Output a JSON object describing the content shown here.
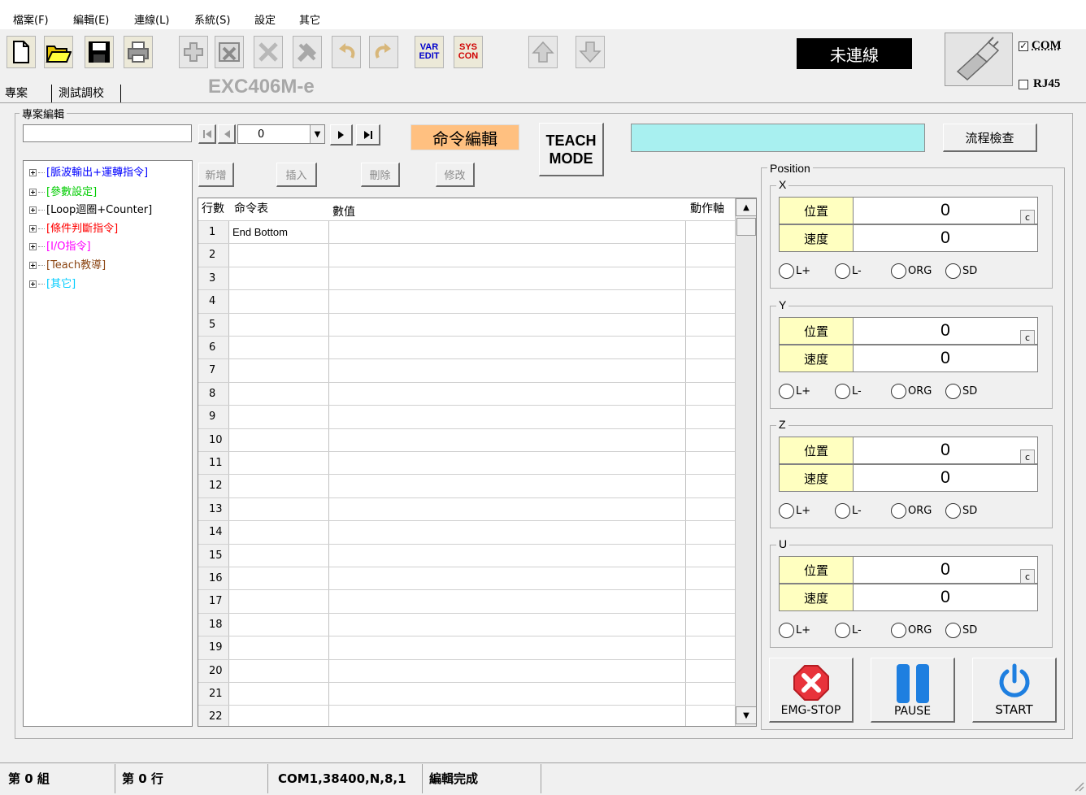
{
  "menu": [
    "檔案(F)",
    "編輯(E)",
    "連線(L)",
    "系統(S)",
    "設定",
    "其它"
  ],
  "toolbar": {
    "var_edit": "VAR EDIT",
    "sys_con": "SYS CON",
    "var_line1": "VAR",
    "var_line2": "EDIT",
    "sys_line1": "SYS",
    "sys_line2": "CON",
    "icons": [
      "new-file-icon",
      "open-folder-icon",
      "save-icon",
      "print-icon",
      "add-icon",
      "delete-window-icon",
      "cross-icon",
      "tools-icon",
      "undo-icon",
      "redo-icon",
      "var-edit-icon",
      "sys-con-icon",
      "arrow-up-icon",
      "arrow-down-icon"
    ]
  },
  "connection": {
    "status": "未連線",
    "com_label": "COM",
    "com_checked": true,
    "rj45_label": "RJ45",
    "rj45_checked": false
  },
  "model_name": "EXC406M-e",
  "tabs": [
    "專案",
    "測試調校"
  ],
  "project": {
    "group_title": "專案編輯",
    "name_value": "",
    "nav_value": "0",
    "cmd_edit_label": "命令編輯",
    "teach_line1": "TEACH",
    "teach_line2": "MODE",
    "info_value": "",
    "flow_check": "流程檢查",
    "buttons": {
      "add": "新增",
      "insert": "插入",
      "delete": "刪除",
      "modify": "修改"
    }
  },
  "tree": [
    {
      "label": "[脈波輸出+運轉指令]",
      "color": "#0000ff"
    },
    {
      "label": "[參數設定]",
      "color": "#00cc00"
    },
    {
      "label": "[Loop迴圈+Counter]",
      "color": "#000000"
    },
    {
      "label": "[條件判斷指令]",
      "color": "#ff0000"
    },
    {
      "label": "[I/O指令]",
      "color": "#ff00ff"
    },
    {
      "label": "[Teach教導]",
      "color": "#8b4513"
    },
    {
      "label": "[其它]",
      "color": "#00ccff"
    }
  ],
  "grid": {
    "headers": [
      "行數",
      "命令表",
      "數值",
      "動作軸"
    ],
    "rows": [
      {
        "no": "1",
        "cmd": "End Bottom",
        "val": "",
        "axis": ""
      },
      {
        "no": "2",
        "cmd": "",
        "val": "",
        "axis": ""
      },
      {
        "no": "3",
        "cmd": "",
        "val": "",
        "axis": ""
      },
      {
        "no": "4",
        "cmd": "",
        "val": "",
        "axis": ""
      },
      {
        "no": "5",
        "cmd": "",
        "val": "",
        "axis": ""
      },
      {
        "no": "6",
        "cmd": "",
        "val": "",
        "axis": ""
      },
      {
        "no": "7",
        "cmd": "",
        "val": "",
        "axis": ""
      },
      {
        "no": "8",
        "cmd": "",
        "val": "",
        "axis": ""
      },
      {
        "no": "9",
        "cmd": "",
        "val": "",
        "axis": ""
      },
      {
        "no": "10",
        "cmd": "",
        "val": "",
        "axis": ""
      },
      {
        "no": "11",
        "cmd": "",
        "val": "",
        "axis": ""
      },
      {
        "no": "12",
        "cmd": "",
        "val": "",
        "axis": ""
      },
      {
        "no": "13",
        "cmd": "",
        "val": "",
        "axis": ""
      },
      {
        "no": "14",
        "cmd": "",
        "val": "",
        "axis": ""
      },
      {
        "no": "15",
        "cmd": "",
        "val": "",
        "axis": ""
      },
      {
        "no": "16",
        "cmd": "",
        "val": "",
        "axis": ""
      },
      {
        "no": "17",
        "cmd": "",
        "val": "",
        "axis": ""
      },
      {
        "no": "18",
        "cmd": "",
        "val": "",
        "axis": ""
      },
      {
        "no": "19",
        "cmd": "",
        "val": "",
        "axis": ""
      },
      {
        "no": "20",
        "cmd": "",
        "val": "",
        "axis": ""
      },
      {
        "no": "21",
        "cmd": "",
        "val": "",
        "axis": ""
      },
      {
        "no": "22",
        "cmd": "",
        "val": "",
        "axis": ""
      }
    ]
  },
  "position": {
    "title": "Position",
    "pos_label": "位置",
    "speed_label": "速度",
    "clear_label": "c",
    "radios": [
      "L+",
      "L-",
      "ORG",
      "SD"
    ],
    "axes": [
      {
        "name": "X",
        "position": "0",
        "speed": "0"
      },
      {
        "name": "Y",
        "position": "0",
        "speed": "0"
      },
      {
        "name": "Z",
        "position": "0",
        "speed": "0"
      },
      {
        "name": "U",
        "position": "0",
        "speed": "0"
      }
    ]
  },
  "controls": {
    "emg_stop": "EMG-STOP",
    "pause": "PAUSE",
    "start": "START",
    "emg_color": "#e8333b",
    "accent_blue": "#1e7fe0"
  },
  "status": {
    "group": "第 0 組",
    "line": "第 0 行",
    "port": "COM1,38400,N,8,1",
    "message": "編輯完成"
  }
}
